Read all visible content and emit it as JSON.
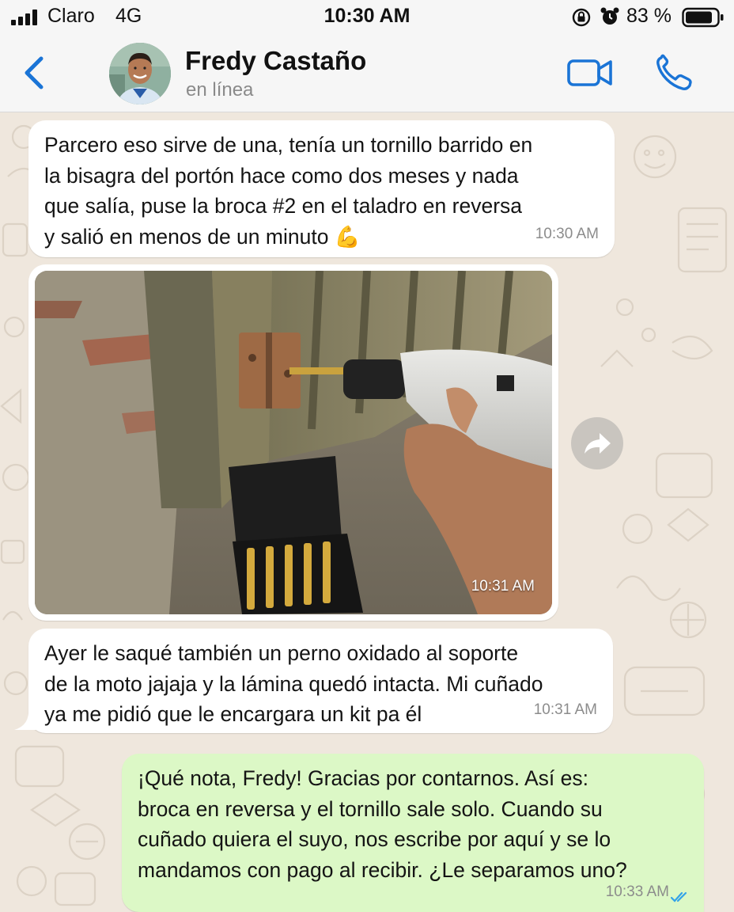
{
  "status_bar": {
    "carrier": "Claro",
    "network": "4G",
    "time": "10:30 AM",
    "battery": "83 %",
    "icons": [
      "signal-icon",
      "lock-icon",
      "alarm-icon",
      "battery-icon"
    ]
  },
  "header": {
    "contact_name": "Fredy Castaño",
    "status": "en línea",
    "icons": [
      "back-icon",
      "video-call-icon",
      "phone-call-icon"
    ]
  },
  "messages": [
    {
      "direction": "in",
      "text": "Parcero eso sirve de una, tenía un tornillo barrido en\nla bisagra del portón hace como dos meses y nada\nque salía, puse la broca  #2 en el taladro en reversa\ny salió en menos de un minuto 💪",
      "time": "10:30 AM"
    },
    {
      "direction": "in",
      "type": "image",
      "alt": "",
      "time": "10:31 AM"
    },
    {
      "direction": "in",
      "text": "Ayer le saqué también un perno oxidado al soporte\nde la moto jajaja y la lámina quedó intacta. Mi cuñado\nya me pidió que le encargara un kit pa él",
      "time": "10:31 AM"
    },
    {
      "direction": "out",
      "text": "¡Qué nota, Fredy! Gracias por contarnos. Así es:\nbroca en reversa y el tornillo sale solo. Cuando su\ncuñado quiera el suyo, nos escribe por aquí y se lo\nmandamos con pago al recibir. ¿Le separamos uno?",
      "time": "10:33 AM",
      "read": true
    }
  ],
  "colors": {
    "accent": "#1a74d6",
    "incoming_bubble": "#ffffff",
    "outgoing_bubble": "#dcf8c6",
    "wallpaper": "#efe7dd",
    "read_ticks": "#34a3e8"
  }
}
